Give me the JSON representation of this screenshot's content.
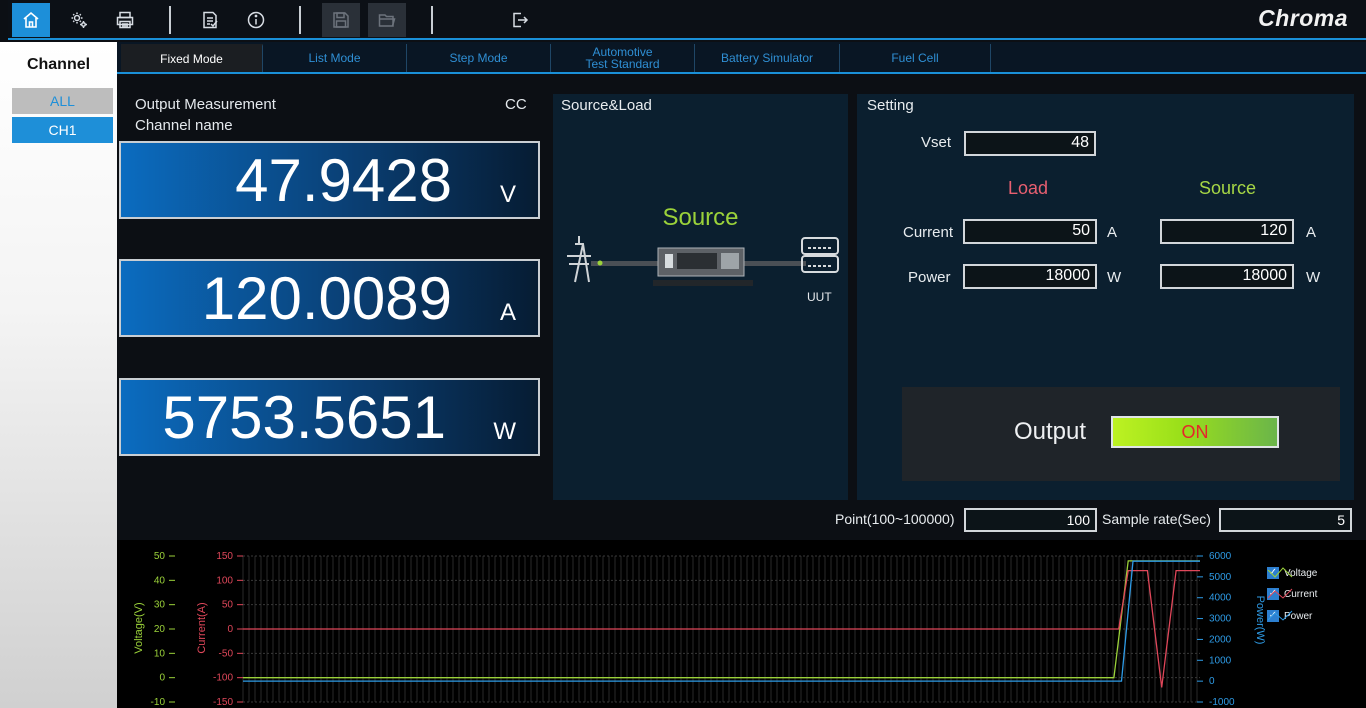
{
  "brand": "Chroma",
  "toolbar": {
    "icons": [
      "home-icon",
      "settings-icon",
      "print-icon",
      "report-icon",
      "info-icon",
      "save-icon",
      "open-folder-icon",
      "exit-icon"
    ]
  },
  "channel_panel": {
    "title": "Channel",
    "items": [
      "ALL",
      "CH1"
    ],
    "selected": "CH1"
  },
  "tabs": [
    {
      "label": "Fixed Mode",
      "active": true
    },
    {
      "label": "List Mode",
      "active": false
    },
    {
      "label": "Step Mode",
      "active": false
    },
    {
      "label": "Automotive\nTest Standard",
      "active": false
    },
    {
      "label": "Battery Simulator",
      "active": false
    },
    {
      "label": "Fuel Cell",
      "active": false
    }
  ],
  "measurement": {
    "title": "Output Measurement",
    "channel_name_label": "Channel name",
    "mode": "CC",
    "voltage": {
      "value": "47.9428",
      "unit": "V"
    },
    "current": {
      "value": "120.0089",
      "unit": "A"
    },
    "power": {
      "value": "5753.5651",
      "unit": "W"
    }
  },
  "source_load": {
    "title": "Source&Load",
    "mode": "Source",
    "uut_label": "UUT"
  },
  "setting": {
    "title": "Setting",
    "vset_label": "Vset",
    "vset": "48",
    "load_header": "Load",
    "source_header": "Source",
    "current_label": "Current",
    "power_label": "Power",
    "load_current": "50",
    "load_power": "18000",
    "source_current": "120",
    "source_power": "18000",
    "current_unit": "A",
    "power_unit": "W",
    "output_label": "Output",
    "output_state": "ON"
  },
  "acquisition": {
    "point_label": "Point(100~100000)",
    "point": "100",
    "sample_rate_label": "Sample rate(Sec)",
    "sample_rate": "5"
  },
  "chart_data": {
    "type": "line",
    "axes": {
      "voltage": {
        "label": "Voltage(V)",
        "ticks": [
          50,
          40,
          30,
          20,
          10,
          0,
          -10
        ],
        "color": "#9bd23a"
      },
      "current": {
        "label": "Current(A)",
        "ticks": [
          150,
          100,
          50,
          0,
          -50,
          -100,
          -150
        ],
        "color": "#e0475a"
      },
      "power": {
        "label": "Power(W)",
        "ticks": [
          6000,
          5000,
          4000,
          3000,
          2000,
          1000,
          0,
          -1000
        ],
        "color": "#2e9be6"
      }
    },
    "series": [
      {
        "name": "Voltage",
        "color": "#9bd23a",
        "axis": "voltage",
        "x": [
          0,
          0.91,
          0.925,
          1.0
        ],
        "y": [
          0,
          0,
          48,
          48
        ]
      },
      {
        "name": "Current",
        "color": "#e0475a",
        "axis": "current",
        "x": [
          0,
          0.915,
          0.925,
          0.945,
          0.96,
          0.975,
          0.99,
          1.0
        ],
        "y": [
          0,
          0,
          120,
          120,
          -120,
          120,
          120,
          120
        ]
      },
      {
        "name": "Power",
        "color": "#2e9be6",
        "axis": "power",
        "x": [
          0,
          0.918,
          0.93,
          1.0
        ],
        "y": [
          0,
          0,
          5750,
          5750
        ]
      }
    ],
    "legend": [
      {
        "name": "Voltage",
        "checked": true
      },
      {
        "name": "Current",
        "checked": true
      },
      {
        "name": "Power",
        "checked": true
      }
    ]
  }
}
